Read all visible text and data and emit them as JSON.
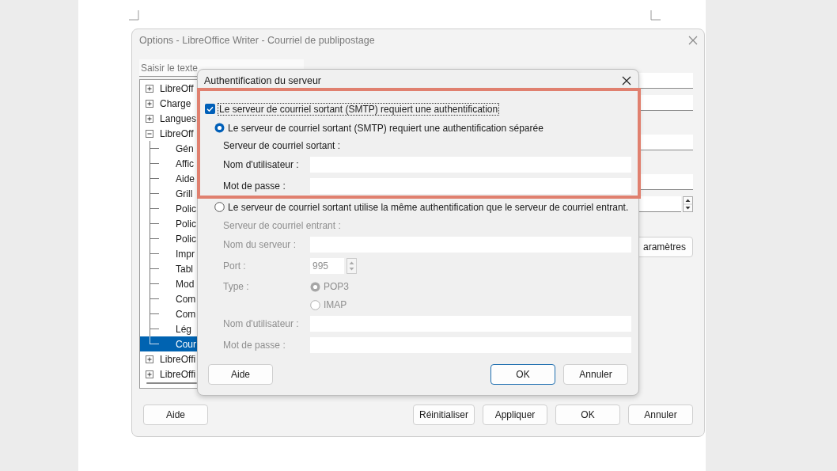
{
  "options_dialog": {
    "title": "Options - LibreOffice Writer - Courriel de publipostage",
    "search": {
      "placeholder": "Saisir le texte"
    },
    "tree": [
      {
        "label": "LibreOff",
        "expanded": false,
        "selected": false
      },
      {
        "label": "Charge",
        "expanded": false,
        "selected": false
      },
      {
        "label": "Langues",
        "expanded": false,
        "selected": false
      },
      {
        "label": "LibreOff",
        "expanded": true,
        "selected": false,
        "children": [
          {
            "label": "Gén",
            "selected": false
          },
          {
            "label": "Affic",
            "selected": false
          },
          {
            "label": "Aide",
            "selected": false
          },
          {
            "label": "Grill",
            "selected": false
          },
          {
            "label": "Polic",
            "selected": false
          },
          {
            "label": "Polic",
            "selected": false
          },
          {
            "label": "Polic",
            "selected": false
          },
          {
            "label": "Impr",
            "selected": false
          },
          {
            "label": "Tabl",
            "selected": false
          },
          {
            "label": "Mod",
            "selected": false
          },
          {
            "label": "Com",
            "selected": false
          },
          {
            "label": "Com",
            "selected": false
          },
          {
            "label": "Lég",
            "selected": false
          },
          {
            "label": "Cour",
            "selected": true
          }
        ]
      },
      {
        "label": "LibreOffi",
        "expanded": false,
        "selected": false
      },
      {
        "label": "LibreOffi",
        "expanded": false,
        "selected": false
      }
    ],
    "fields": [
      {
        "kind": "text"
      },
      {
        "kind": "text"
      },
      {
        "kind": "gap"
      },
      {
        "kind": "text"
      },
      {
        "kind": "gap"
      },
      {
        "kind": "text"
      },
      {
        "kind": "spin"
      }
    ],
    "side_button": {
      "label": "aramètres"
    },
    "buttons": [
      {
        "label": "Aide",
        "kind": "left"
      },
      {
        "label": "Réinitialiser",
        "kind": "right"
      },
      {
        "label": "Appliquer",
        "kind": "right"
      },
      {
        "label": "OK",
        "kind": "right"
      },
      {
        "label": "Annuler",
        "kind": "right"
      }
    ]
  },
  "auth_dialog": {
    "title": "Authentification du serveur",
    "require_auth": {
      "label": "Le serveur de courriel sortant (SMTP) requiert une authentification",
      "checked": true
    },
    "modes": [
      {
        "label": "Le serveur de courriel sortant (SMTP) requiert une authentification séparée",
        "selected": true
      },
      {
        "label": "Le serveur de courriel sortant utilise la même authentification que le serveur de courriel entrant.",
        "selected": false
      }
    ],
    "outgoing": {
      "heading": "Serveur de courriel sortant :",
      "disabled": false,
      "fields": [
        {
          "label": "Nom d'utilisateur :"
        },
        {
          "label": "Mot de passe :"
        }
      ]
    },
    "incoming": {
      "heading": "Serveur de courriel entrant :",
      "disabled": true,
      "server": {
        "label": "Nom du serveur :"
      },
      "port": {
        "label": "Port :",
        "value": "995"
      },
      "type": {
        "label": "Type :",
        "options": [
          {
            "label": "POP3",
            "selected": true
          },
          {
            "label": "IMAP",
            "selected": false
          }
        ]
      },
      "fields": [
        {
          "label": "Nom d'utilisateur :"
        },
        {
          "label": "Mot de passe :"
        }
      ]
    },
    "buttons": [
      {
        "label": "Aide",
        "kind": "left",
        "default": false
      },
      {
        "label": "OK",
        "kind": "right",
        "default": true
      },
      {
        "label": "Annuler",
        "kind": "right",
        "default": false
      }
    ]
  }
}
